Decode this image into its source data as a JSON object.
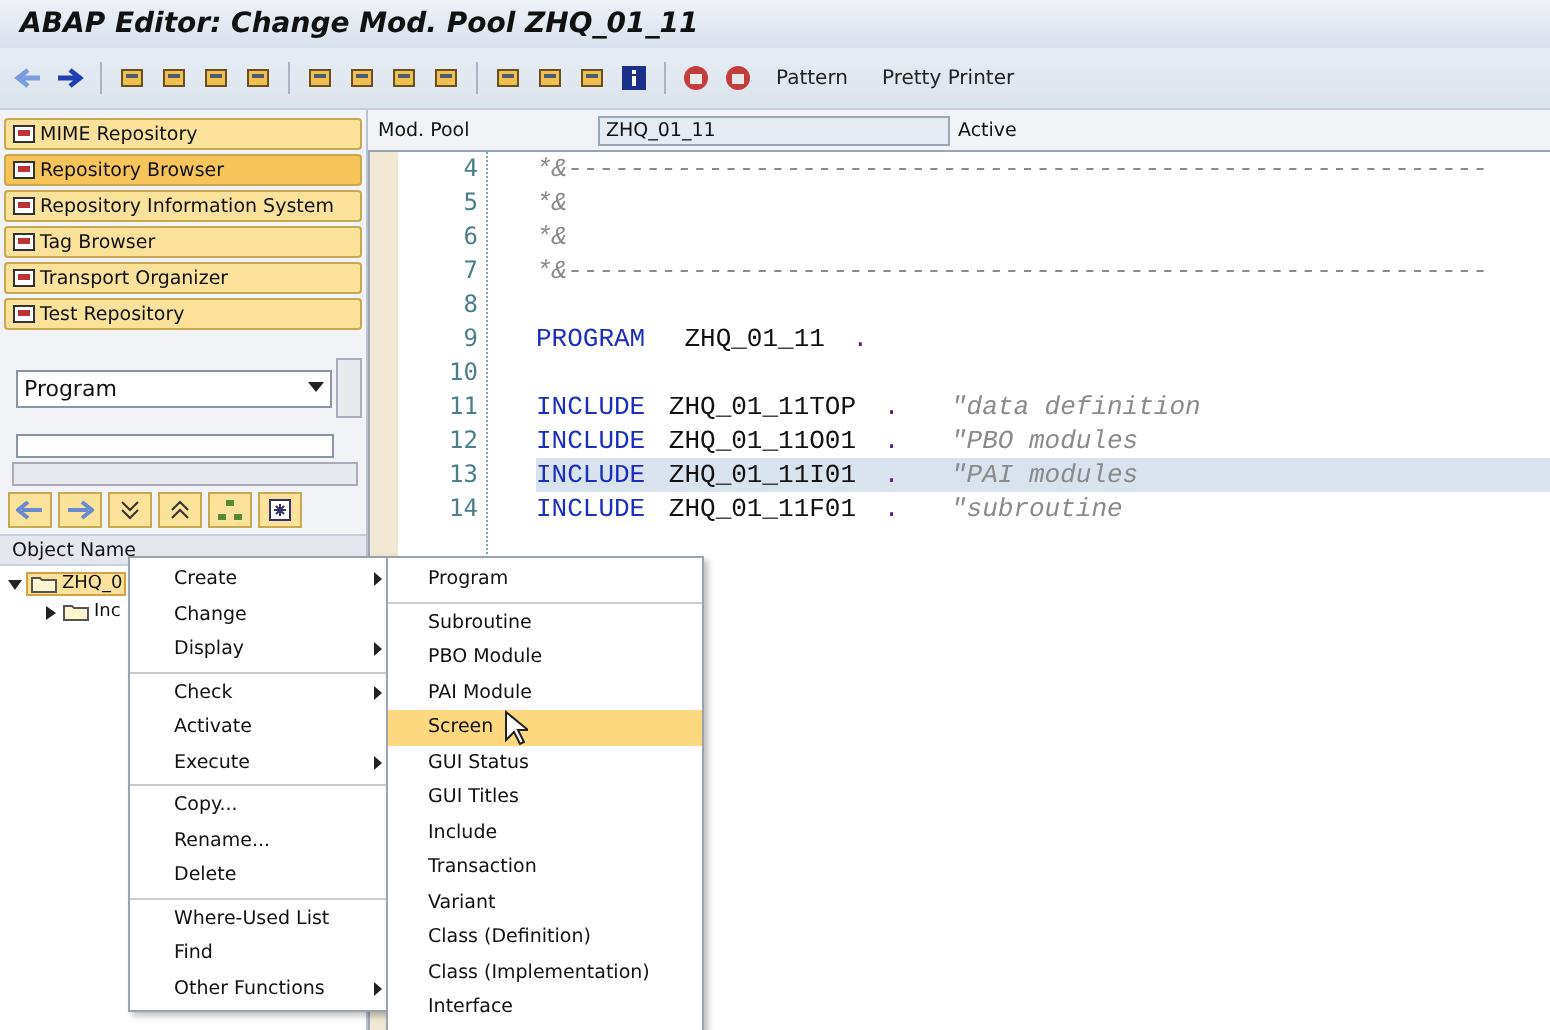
{
  "window": {
    "title": "ABAP Editor: Change Mod. Pool ZHQ_01_11"
  },
  "toolbar": {
    "buttons": [
      "Pattern",
      "Pretty Printer"
    ]
  },
  "navigation": [
    {
      "label": "MIME Repository",
      "selected": false
    },
    {
      "label": "Repository Browser",
      "selected": true
    },
    {
      "label": "Repository Information System",
      "selected": false
    },
    {
      "label": "Tag Browser",
      "selected": false
    },
    {
      "label": "Transport Organizer",
      "selected": false
    },
    {
      "label": "Test Repository",
      "selected": false
    }
  ],
  "object_type": {
    "value": "Program"
  },
  "tree": {
    "header": "Object Name",
    "items": [
      {
        "label": "ZHQ_0",
        "expanded": true,
        "children": [
          {
            "label": "Inc",
            "expanded": false
          }
        ]
      }
    ]
  },
  "header": {
    "label": "Mod. Pool",
    "value": "ZHQ_01_11",
    "status": "Active"
  },
  "code": [
    {
      "number": "4",
      "kind": "comment",
      "text": "*&-----------------------------------------------------------",
      "selected": false
    },
    {
      "number": "5",
      "kind": "comment",
      "text": "*&",
      "selected": false
    },
    {
      "number": "6",
      "kind": "comment",
      "text": "*&",
      "selected": false
    },
    {
      "number": "7",
      "kind": "comment",
      "text": "*&-----------------------------------------------------------",
      "selected": false
    },
    {
      "number": "8",
      "kind": "blank",
      "selected": false
    },
    {
      "number": "9",
      "kind": "code",
      "keyword": "PROGRAM",
      "operand": " ZHQ_01_11",
      "period": ".",
      "selected": false
    },
    {
      "number": "10",
      "kind": "blank",
      "selected": false
    },
    {
      "number": "11",
      "kind": "code",
      "keyword": "INCLUDE",
      "operand": "ZHQ_01_11TOP",
      "period": ".",
      "note": "\"data definition",
      "selected": false
    },
    {
      "number": "12",
      "kind": "code",
      "keyword": "INCLUDE",
      "operand": "ZHQ_01_11O01",
      "period": ".",
      "note": "\"PBO modules",
      "selected": false
    },
    {
      "number": "13",
      "kind": "code",
      "keyword": "INCLUDE",
      "operand": "ZHQ_01_11I01",
      "period": ".",
      "note": "\"PAI modules",
      "selected": true
    },
    {
      "number": "14",
      "kind": "code",
      "keyword": "INCLUDE",
      "operand": "ZHQ_01_11F01",
      "period": ".",
      "note": "\"subroutine",
      "selected": false
    }
  ],
  "context_menu": [
    {
      "label": "Create",
      "submenu": true,
      "separator_before": false
    },
    {
      "label": "Change",
      "submenu": false,
      "separator_before": false
    },
    {
      "label": "Display",
      "submenu": true,
      "separator_before": false
    },
    {
      "label": "Check",
      "submenu": true,
      "separator_before": true
    },
    {
      "label": "Activate",
      "submenu": false,
      "separator_before": false
    },
    {
      "label": "Execute",
      "submenu": true,
      "separator_before": false
    },
    {
      "label": "Copy...",
      "submenu": false,
      "separator_before": true
    },
    {
      "label": "Rename...",
      "submenu": false,
      "separator_before": false
    },
    {
      "label": "Delete",
      "submenu": false,
      "separator_before": false
    },
    {
      "label": "Where-Used List",
      "submenu": false,
      "separator_before": true
    },
    {
      "label": "Find",
      "submenu": false,
      "separator_before": false
    },
    {
      "label": "Other Functions",
      "submenu": true,
      "separator_before": false
    }
  ],
  "submenu": [
    {
      "label": "Program",
      "separator_before": false,
      "selected": false
    },
    {
      "label": "Subroutine",
      "separator_before": true,
      "selected": false
    },
    {
      "label": "PBO Module",
      "separator_before": false,
      "selected": false
    },
    {
      "label": "PAI Module",
      "separator_before": false,
      "selected": false
    },
    {
      "label": "Screen",
      "separator_before": false,
      "selected": true
    },
    {
      "label": "GUI Status",
      "separator_before": false,
      "selected": false
    },
    {
      "label": "GUI Titles",
      "separator_before": false,
      "selected": false
    },
    {
      "label": "Include",
      "separator_before": false,
      "selected": false
    },
    {
      "label": "Transaction",
      "separator_before": false,
      "selected": false
    },
    {
      "label": "Variant",
      "separator_before": false,
      "selected": false
    },
    {
      "label": "Class (Definition)",
      "separator_before": false,
      "selected": false
    },
    {
      "label": "Class (Implementation)",
      "separator_before": false,
      "selected": false
    },
    {
      "label": "Interface",
      "separator_before": false,
      "selected": false
    }
  ]
}
